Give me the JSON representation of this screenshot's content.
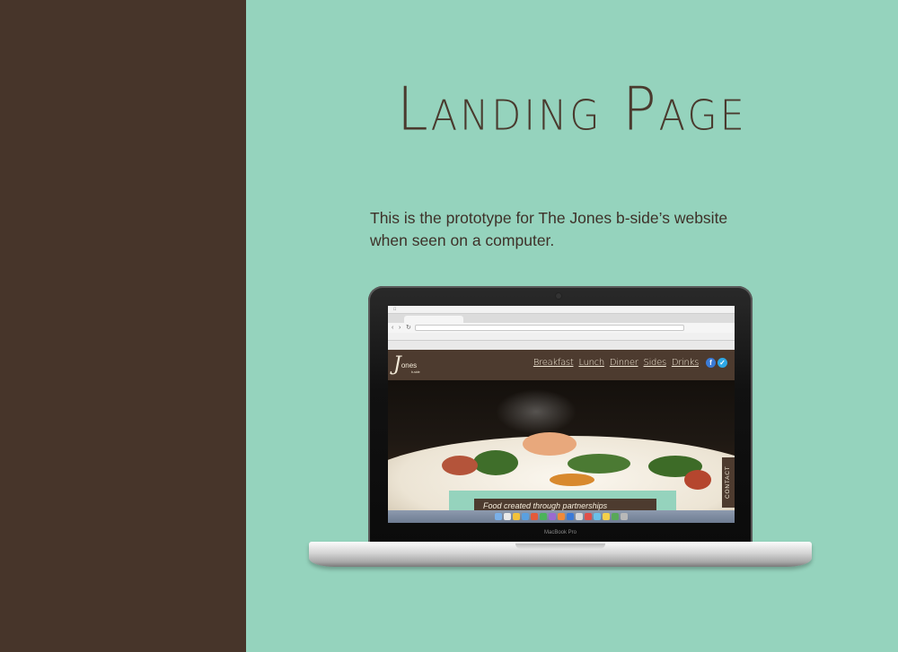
{
  "page": {
    "title": "Landing Page",
    "description": "This is the prototype for The Jones b-side’s website when seen on a computer."
  },
  "laptop": {
    "chin_label": "MacBook Pro"
  },
  "site": {
    "logo_letter": "J",
    "logo_text": "ones",
    "logo_sub": "b-side",
    "nav": [
      "Breakfast",
      "Lunch",
      "Dinner",
      "Sides",
      "Drinks"
    ],
    "social": [
      "facebook-icon",
      "twitter-icon"
    ],
    "contact_label": "CONTACT",
    "tagline": "Food created through partnerships"
  },
  "colors": {
    "sidebar": "#47352a",
    "background": "#95d3bd",
    "text": "#4a3a2e",
    "site_brown": "#4d3b2f"
  }
}
